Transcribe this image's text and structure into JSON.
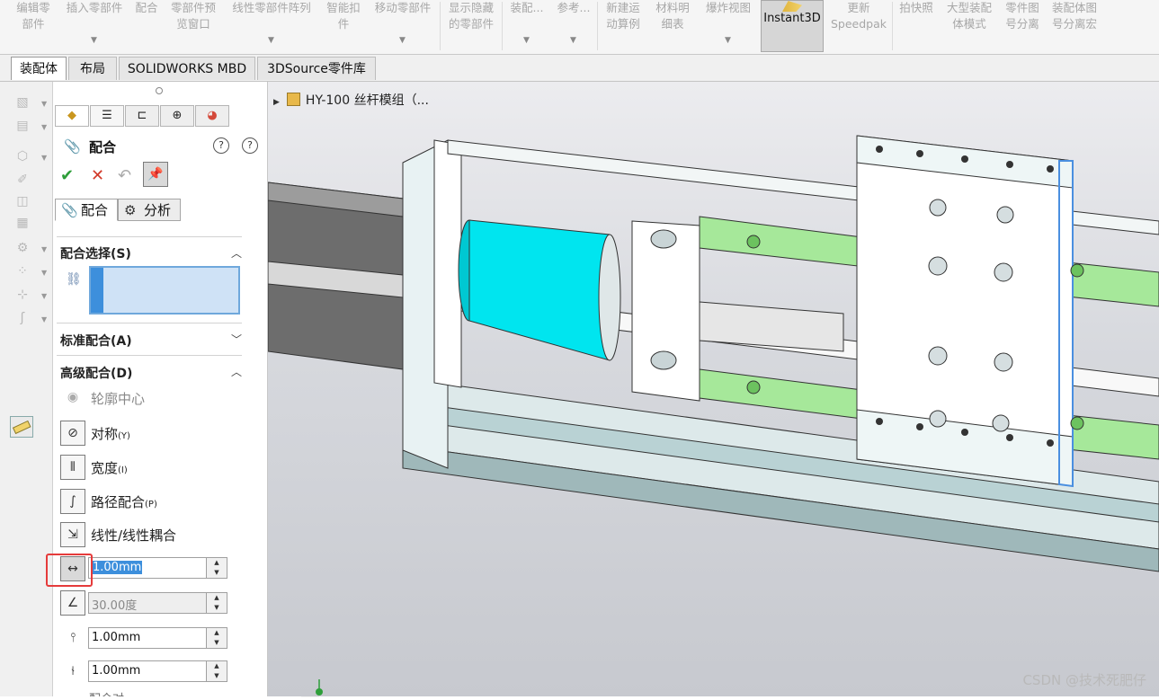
{
  "ribbon": {
    "buttons": [
      {
        "line1": "编辑零",
        "line2": "部件",
        "dd": false
      },
      {
        "line1": "插入零部件",
        "line2": "",
        "dd": true
      },
      {
        "line1": "配合",
        "line2": "",
        "dd": false
      },
      {
        "line1": "零部件预",
        "line2": "览窗口",
        "dd": false
      },
      {
        "line1": "线性零部件阵列",
        "line2": "",
        "dd": true
      },
      {
        "line1": "智能扣",
        "line2": "件",
        "dd": false
      },
      {
        "line1": "移动零部件",
        "line2": "",
        "dd": true
      },
      {
        "line1": "显示隐藏",
        "line2": "的零部件",
        "dd": false
      },
      {
        "line1": "装配...",
        "line2": "",
        "dd": true
      },
      {
        "line1": "参考...",
        "line2": "",
        "dd": true
      },
      {
        "line1": "新建运",
        "line2": "动算例",
        "dd": false
      },
      {
        "line1": "材料明",
        "line2": "细表",
        "dd": false
      },
      {
        "line1": "爆炸视图",
        "line2": "",
        "dd": true
      },
      {
        "line1": "Instant3D",
        "line2": "",
        "dd": false
      },
      {
        "line1": "更新",
        "line2": "Speedpak",
        "dd": false
      },
      {
        "line1": "拍快照",
        "line2": "",
        "dd": false
      },
      {
        "line1": "大型装配",
        "line2": "体模式",
        "dd": false
      },
      {
        "line1": "零件图",
        "line2": "号分离",
        "dd": false
      },
      {
        "line1": "装配体图",
        "line2": "号分离宏",
        "dd": false
      }
    ]
  },
  "command_tabs": [
    "装配体",
    "布局",
    "SOLIDWORKS MBD",
    "3DSource零件库"
  ],
  "pm": {
    "title": "配合",
    "subtabs": [
      "配合",
      "分析"
    ],
    "sections": {
      "selection": "配合选择(S)",
      "standard": "标准配合(A)",
      "advanced": "高级配合(D)"
    },
    "advanced_options": [
      {
        "label": "轮廓中心",
        "key": "",
        "enabled": false
      },
      {
        "label": "对称",
        "key": "(Y)",
        "enabled": true
      },
      {
        "label": "宽度",
        "key": "(I)",
        "enabled": true
      },
      {
        "label": "路径配合",
        "key": "(P)",
        "enabled": true
      },
      {
        "label": "线性/线性耦合",
        "key": "",
        "enabled": true
      }
    ],
    "distance_value": "1.00mm",
    "angle_value": "30.00度",
    "limit_max": "1.00mm",
    "limit_min": "1.00mm",
    "cut_text": "配合对..."
  },
  "tree": {
    "root": "HY-100 丝杆模组（..."
  },
  "watermark": "CSDN @技术死肥仔",
  "colors": {
    "accent": "#3d8fdc",
    "highlight_part": "#00e5ef",
    "rail_green": "#a6e89a",
    "red_annotation": "#e53b3b"
  }
}
